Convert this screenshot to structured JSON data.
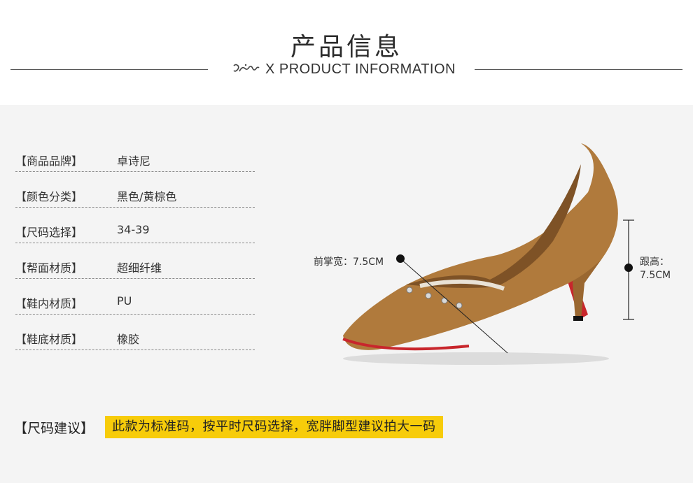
{
  "header": {
    "title": "产品信息",
    "brand_logo": "Joshiny",
    "separator": "X",
    "subtitle": "PRODUCT INFORMATION"
  },
  "specs": [
    {
      "label": "【商品品牌】",
      "value": "卓诗尼"
    },
    {
      "label": "【颜色分类】",
      "value": "黑色/黄棕色"
    },
    {
      "label": "【尺码选择】",
      "value": "34-39"
    },
    {
      "label": "【帮面材质】",
      "value": "超细纤维"
    },
    {
      "label": "【鞋内材质】",
      "value": "PU"
    },
    {
      "label": "【鞋底材质】",
      "value": "橡胶"
    }
  ],
  "annotations": {
    "forefoot": "前掌宽：7.5CM",
    "heel_label": "跟高：",
    "heel_value": "7.5CM"
  },
  "advice": {
    "label": "【尺码建议】",
    "text": "此款为标准码，按平时尺码选择，宽胖脚型建议拍大一码"
  },
  "colors": {
    "accent_highlight": "#f7cc0a",
    "shoe_suede": "#b07a3c",
    "sole_red": "#c8262c"
  }
}
